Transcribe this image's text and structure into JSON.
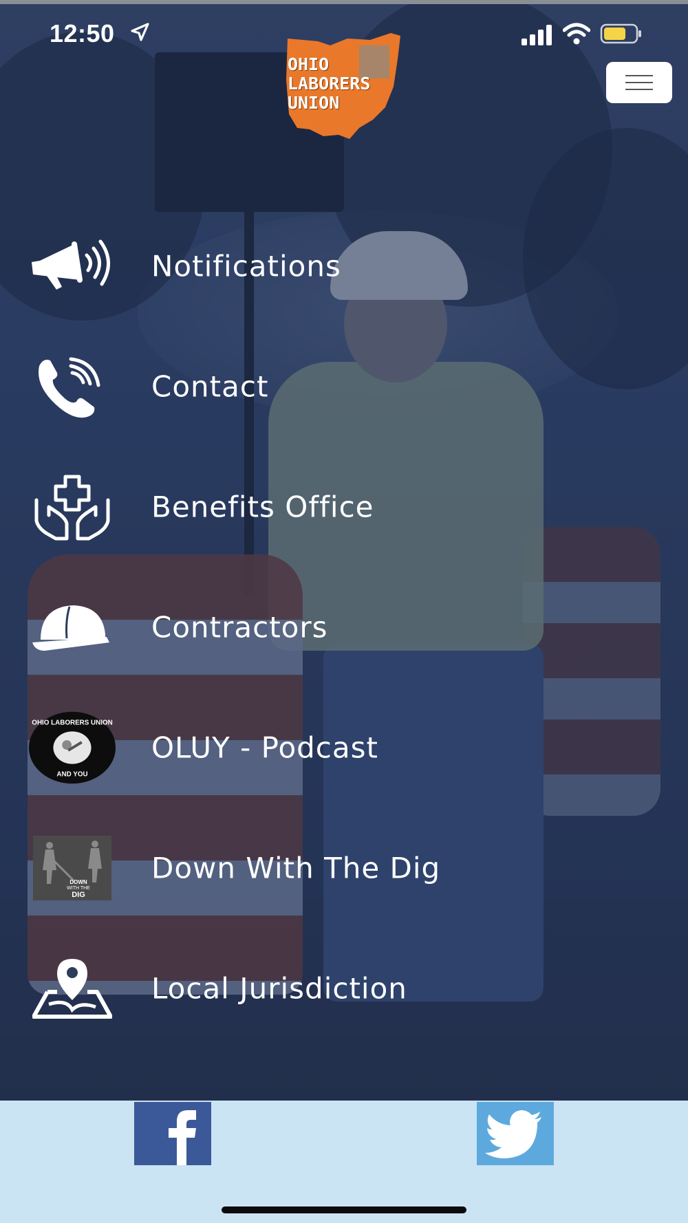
{
  "status_bar": {
    "time": "12:50"
  },
  "logo": {
    "line1": "OHIO",
    "line2": "LABORERS",
    "line3": "UNION"
  },
  "menu": {
    "items": [
      {
        "label": "Notifications",
        "icon": "megaphone-icon"
      },
      {
        "label": "Contact",
        "icon": "phone-icon"
      },
      {
        "label": "Benefits Office",
        "icon": "hands-cross-icon"
      },
      {
        "label": "Contractors",
        "icon": "hard-hat-icon"
      },
      {
        "label": "OLUY - Podcast",
        "icon": "podcast-logo-icon"
      },
      {
        "label": "Down With The Dig",
        "icon": "down-with-the-dig-thumbnail"
      },
      {
        "label": "Local Jurisdiction",
        "icon": "map-pin-icon"
      }
    ]
  },
  "podcast_badge": {
    "top": "OHIO LABORERS UNION",
    "bottom": "AND YOU"
  },
  "dig_thumb": {
    "line1": "DOWN",
    "line2": "WITH THE",
    "line3": "DIG"
  },
  "footer": {
    "facebook_icon": "facebook-icon",
    "twitter_icon": "twitter-icon"
  },
  "colors": {
    "footer_bg": "#cae4f4",
    "facebook": "#3b5998",
    "twitter": "#5da9dd",
    "logo_orange": "#e9782a",
    "battery_yellow": "#f5d547"
  }
}
